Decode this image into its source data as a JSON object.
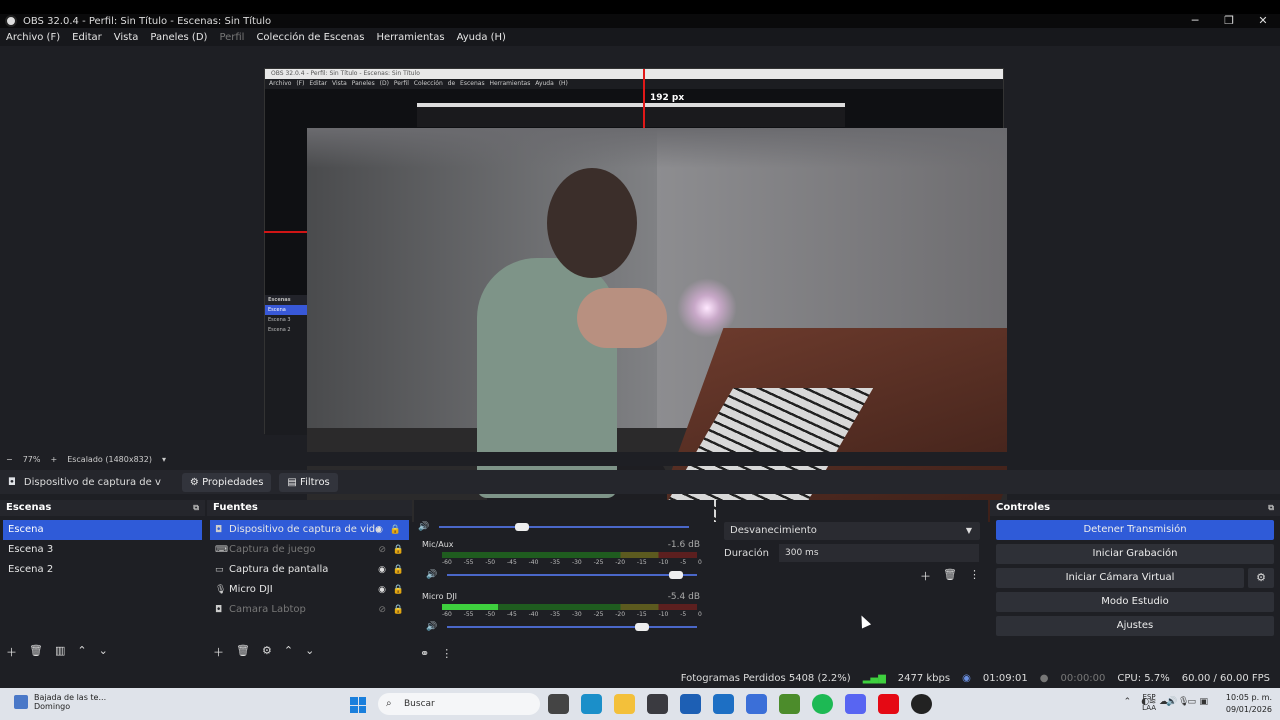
{
  "window": {
    "title": "OBS 32.0.4 - Perfil: Sin Título - Escenas: Sin Título",
    "minimize": "─",
    "maximize": "❐",
    "close": "✕"
  },
  "menu": [
    "Archivo (F)",
    "Editar",
    "Vista",
    "Paneles (D)",
    "Perfil",
    "Colección de Escenas",
    "Herramientas",
    "Ayuda (H)"
  ],
  "preview": {
    "nested_title": "OBS 32.0.4 - Perfil: Sin Título - Escenas: Sin Título",
    "nested_menu": "Archivo (F)  Editar  Vista  Paneles (D)  Perfil  Colección de Escenas  Herramientas  Ayuda (H)",
    "measure_label": "192 px",
    "nested_scenes": [
      "Escenas",
      "Escena",
      "Escena 3",
      "Escena 2"
    ]
  },
  "zoom": {
    "minus": "−",
    "value": "77%",
    "plus": "+",
    "scale": "Escalado (1480x832)"
  },
  "source_bar": {
    "name": "Dispositivo de captura de v",
    "properties": "Propiedades",
    "filters": "Filtros"
  },
  "scenes": {
    "header": "Escenas",
    "items": [
      "Escena",
      "Escena 3",
      "Escena 2"
    ],
    "selected_index": 0
  },
  "sources": {
    "header": "Fuentes",
    "items": [
      {
        "label": "Dispositivo de captura de vide",
        "icon": "camera-icon",
        "selected": true,
        "visible": true
      },
      {
        "label": "Captura de juego",
        "icon": "gamepad-icon",
        "selected": false,
        "visible": false
      },
      {
        "label": "Captura de pantalla",
        "icon": "monitor-icon",
        "selected": false,
        "visible": true
      },
      {
        "label": "Micro DJI",
        "icon": "mic-icon",
        "selected": false,
        "visible": true
      },
      {
        "label": "Camara Labtop",
        "icon": "camera-icon",
        "selected": false,
        "visible": false
      }
    ]
  },
  "mixer": {
    "tracks": [
      {
        "name": "Mic/Aux",
        "db": "-1.6 dB",
        "level": 0
      },
      {
        "name": "Micro DJI",
        "db": "-5.4 dB",
        "level": 0.22
      }
    ],
    "scale": [
      "-60",
      "-55",
      "-50",
      "-45",
      "-40",
      "-35",
      "-30",
      "-25",
      "-20",
      "-15",
      "-10",
      "-5",
      "0"
    ]
  },
  "transitions": {
    "type": "Desvanecimiento",
    "duration_label": "Duración",
    "duration_value": "300 ms"
  },
  "controls": {
    "header": "Controles",
    "stop_stream": "Detener Transmisión",
    "start_record": "Iniciar Grabación",
    "virtual_cam": "Iniciar Cámara Virtual",
    "studio": "Modo Estudio",
    "settings": "Ajustes"
  },
  "status": {
    "dropped": "Fotogramas Perdidos 5408 (2.2%)",
    "bitrate": "2477 kbps",
    "stream_time": "01:09:01",
    "rec_time": "00:00:00",
    "cpu": "CPU: 5.7%",
    "fps": "60.00 / 60.00 FPS"
  },
  "taskbar": {
    "news_title": "Bajada de las te...",
    "news_sub": "Domingo",
    "search": "Buscar",
    "lang1": "ESP",
    "lang2": "LAA",
    "time": "10:05 p. m.",
    "date": "09/01/2026"
  }
}
